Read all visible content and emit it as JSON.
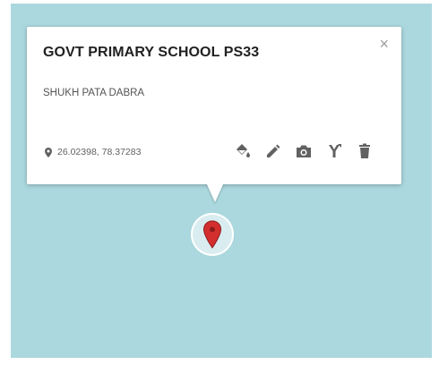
{
  "popup": {
    "title": "GOVT PRIMARY SCHOOL PS33",
    "description": "SHUKH PATA DABRA",
    "coordinates": "26.02398, 78.37283",
    "close_glyph": "×"
  },
  "toolbar": {
    "icons": [
      "paint-bucket-icon",
      "pencil-icon",
      "camera-icon",
      "directions-icon",
      "trash-icon"
    ]
  },
  "colors": {
    "map_water": "#abd7de",
    "marker_red": "#d32f2f"
  }
}
